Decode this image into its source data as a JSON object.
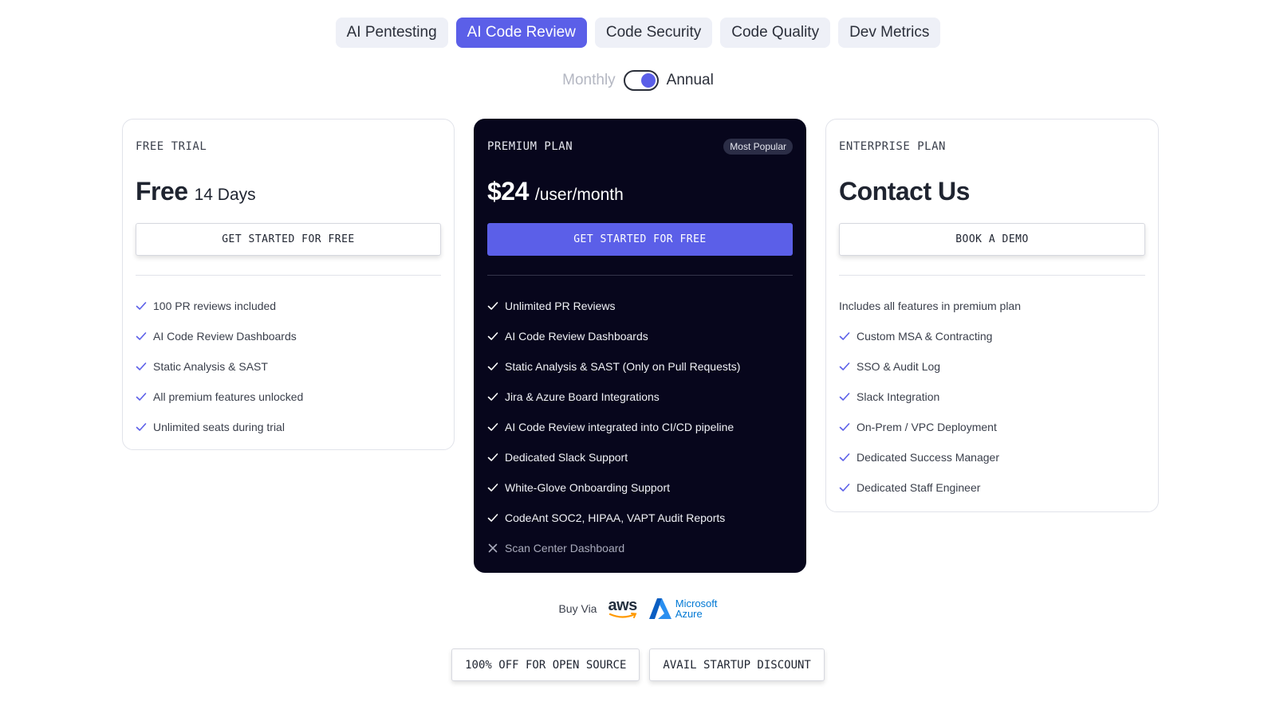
{
  "tabs": [
    {
      "label": "AI Pentesting",
      "active": false
    },
    {
      "label": "AI Code Review",
      "active": true
    },
    {
      "label": "Code Security",
      "active": false
    },
    {
      "label": "Code Quality",
      "active": false
    },
    {
      "label": "Dev Metrics",
      "active": false
    }
  ],
  "billing": {
    "monthly_label": "Monthly",
    "annual_label": "Annual",
    "selected": "Annual"
  },
  "plans": {
    "free": {
      "name": "FREE TRIAL",
      "price": "Free",
      "price_suffix": "14 Days",
      "cta": "GET STARTED FOR FREE",
      "features": [
        "100 PR reviews included",
        "AI Code Review Dashboards",
        "Static Analysis & SAST",
        "All premium features unlocked",
        "Unlimited seats during trial"
      ]
    },
    "premium": {
      "name": "PREMIUM PLAN",
      "badge": "Most Popular",
      "price": "$24",
      "price_suffix": "/user/month",
      "cta": "GET STARTED FOR FREE",
      "features": [
        "Unlimited PR Reviews",
        "AI Code Review Dashboards",
        "Static Analysis & SAST (Only on Pull Requests)",
        "Jira & Azure Board Integrations",
        "AI Code Review integrated into CI/CD pipeline",
        "Dedicated Slack Support",
        "White-Glove Onboarding Support",
        "CodeAnt SOC2, HIPAA, VAPT Audit Reports"
      ],
      "excluded_features": [
        "Scan Center Dashboard"
      ]
    },
    "enterprise": {
      "name": "ENTERPRISE PLAN",
      "price": "Contact Us",
      "cta": "BOOK A DEMO",
      "note": "Includes all features in premium plan",
      "features": [
        "Custom MSA & Contracting",
        "SSO & Audit Log",
        "Slack Integration",
        "On-Prem / VPC Deployment",
        "Dedicated Success Manager",
        "Dedicated Staff Engineer"
      ]
    }
  },
  "buy_via": {
    "label": "Buy Via",
    "aws": "aws",
    "azure_line1": "Microsoft",
    "azure_line2": "Azure"
  },
  "bottom_buttons": {
    "open_source": "100% OFF FOR OPEN SOURCE",
    "startup": "AVAIL STARTUP DISCOUNT"
  },
  "colors": {
    "accent": "#5b5fe8",
    "premium_bg": "#07061c",
    "tab_bg": "#eef0f7"
  },
  "icons": {
    "included": "check-icon",
    "excluded": "x-icon"
  }
}
